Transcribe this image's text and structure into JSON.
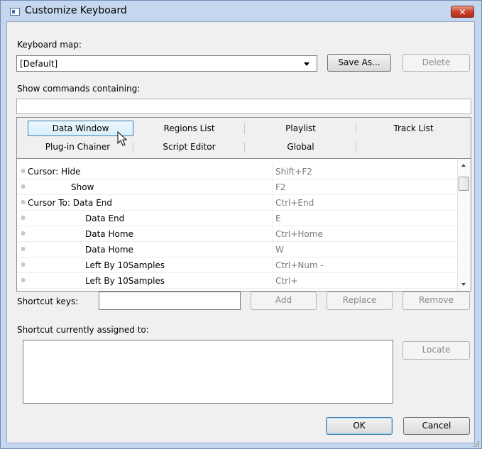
{
  "window": {
    "title": "Customize Keyboard",
    "close_glyph": "✕"
  },
  "keyboard_map": {
    "label": "Keyboard map:",
    "value": "[Default]",
    "save_as": "Save As...",
    "delete": "Delete"
  },
  "filter": {
    "label": "Show commands containing:",
    "value": ""
  },
  "tabs": [
    {
      "label": "Data Window",
      "active": true
    },
    {
      "label": "Regions List"
    },
    {
      "label": "Playlist"
    },
    {
      "label": "Track List"
    },
    {
      "label": "Plug-in Chainer"
    },
    {
      "label": "Script Editor"
    },
    {
      "label": "Global"
    }
  ],
  "commands": [
    {
      "command": "Cursor: Hide",
      "key": "Shift+F2",
      "indent": 0
    },
    {
      "command": "Show",
      "key": "F2",
      "indent": 1
    },
    {
      "command": "Cursor To: Data End",
      "key": "Ctrl+End",
      "indent": 0
    },
    {
      "command": "Data End",
      "key": "E",
      "indent": 2
    },
    {
      "command": "Data Home",
      "key": "Ctrl+Home",
      "indent": 2
    },
    {
      "command": "Data Home",
      "key": "W",
      "indent": 2
    },
    {
      "command": "Left By 10Samples",
      "key": "Ctrl+Num -",
      "indent": 2
    },
    {
      "command": "Left By 10Samples",
      "key": "Ctrl+",
      "indent": 2
    }
  ],
  "shortcut": {
    "label": "Shortcut keys:",
    "value": "",
    "add": "Add",
    "replace": "Replace",
    "remove": "Remove"
  },
  "assigned": {
    "label": "Shortcut currently assigned to:",
    "locate": "Locate"
  },
  "footer": {
    "ok": "OK",
    "cancel": "Cancel"
  }
}
